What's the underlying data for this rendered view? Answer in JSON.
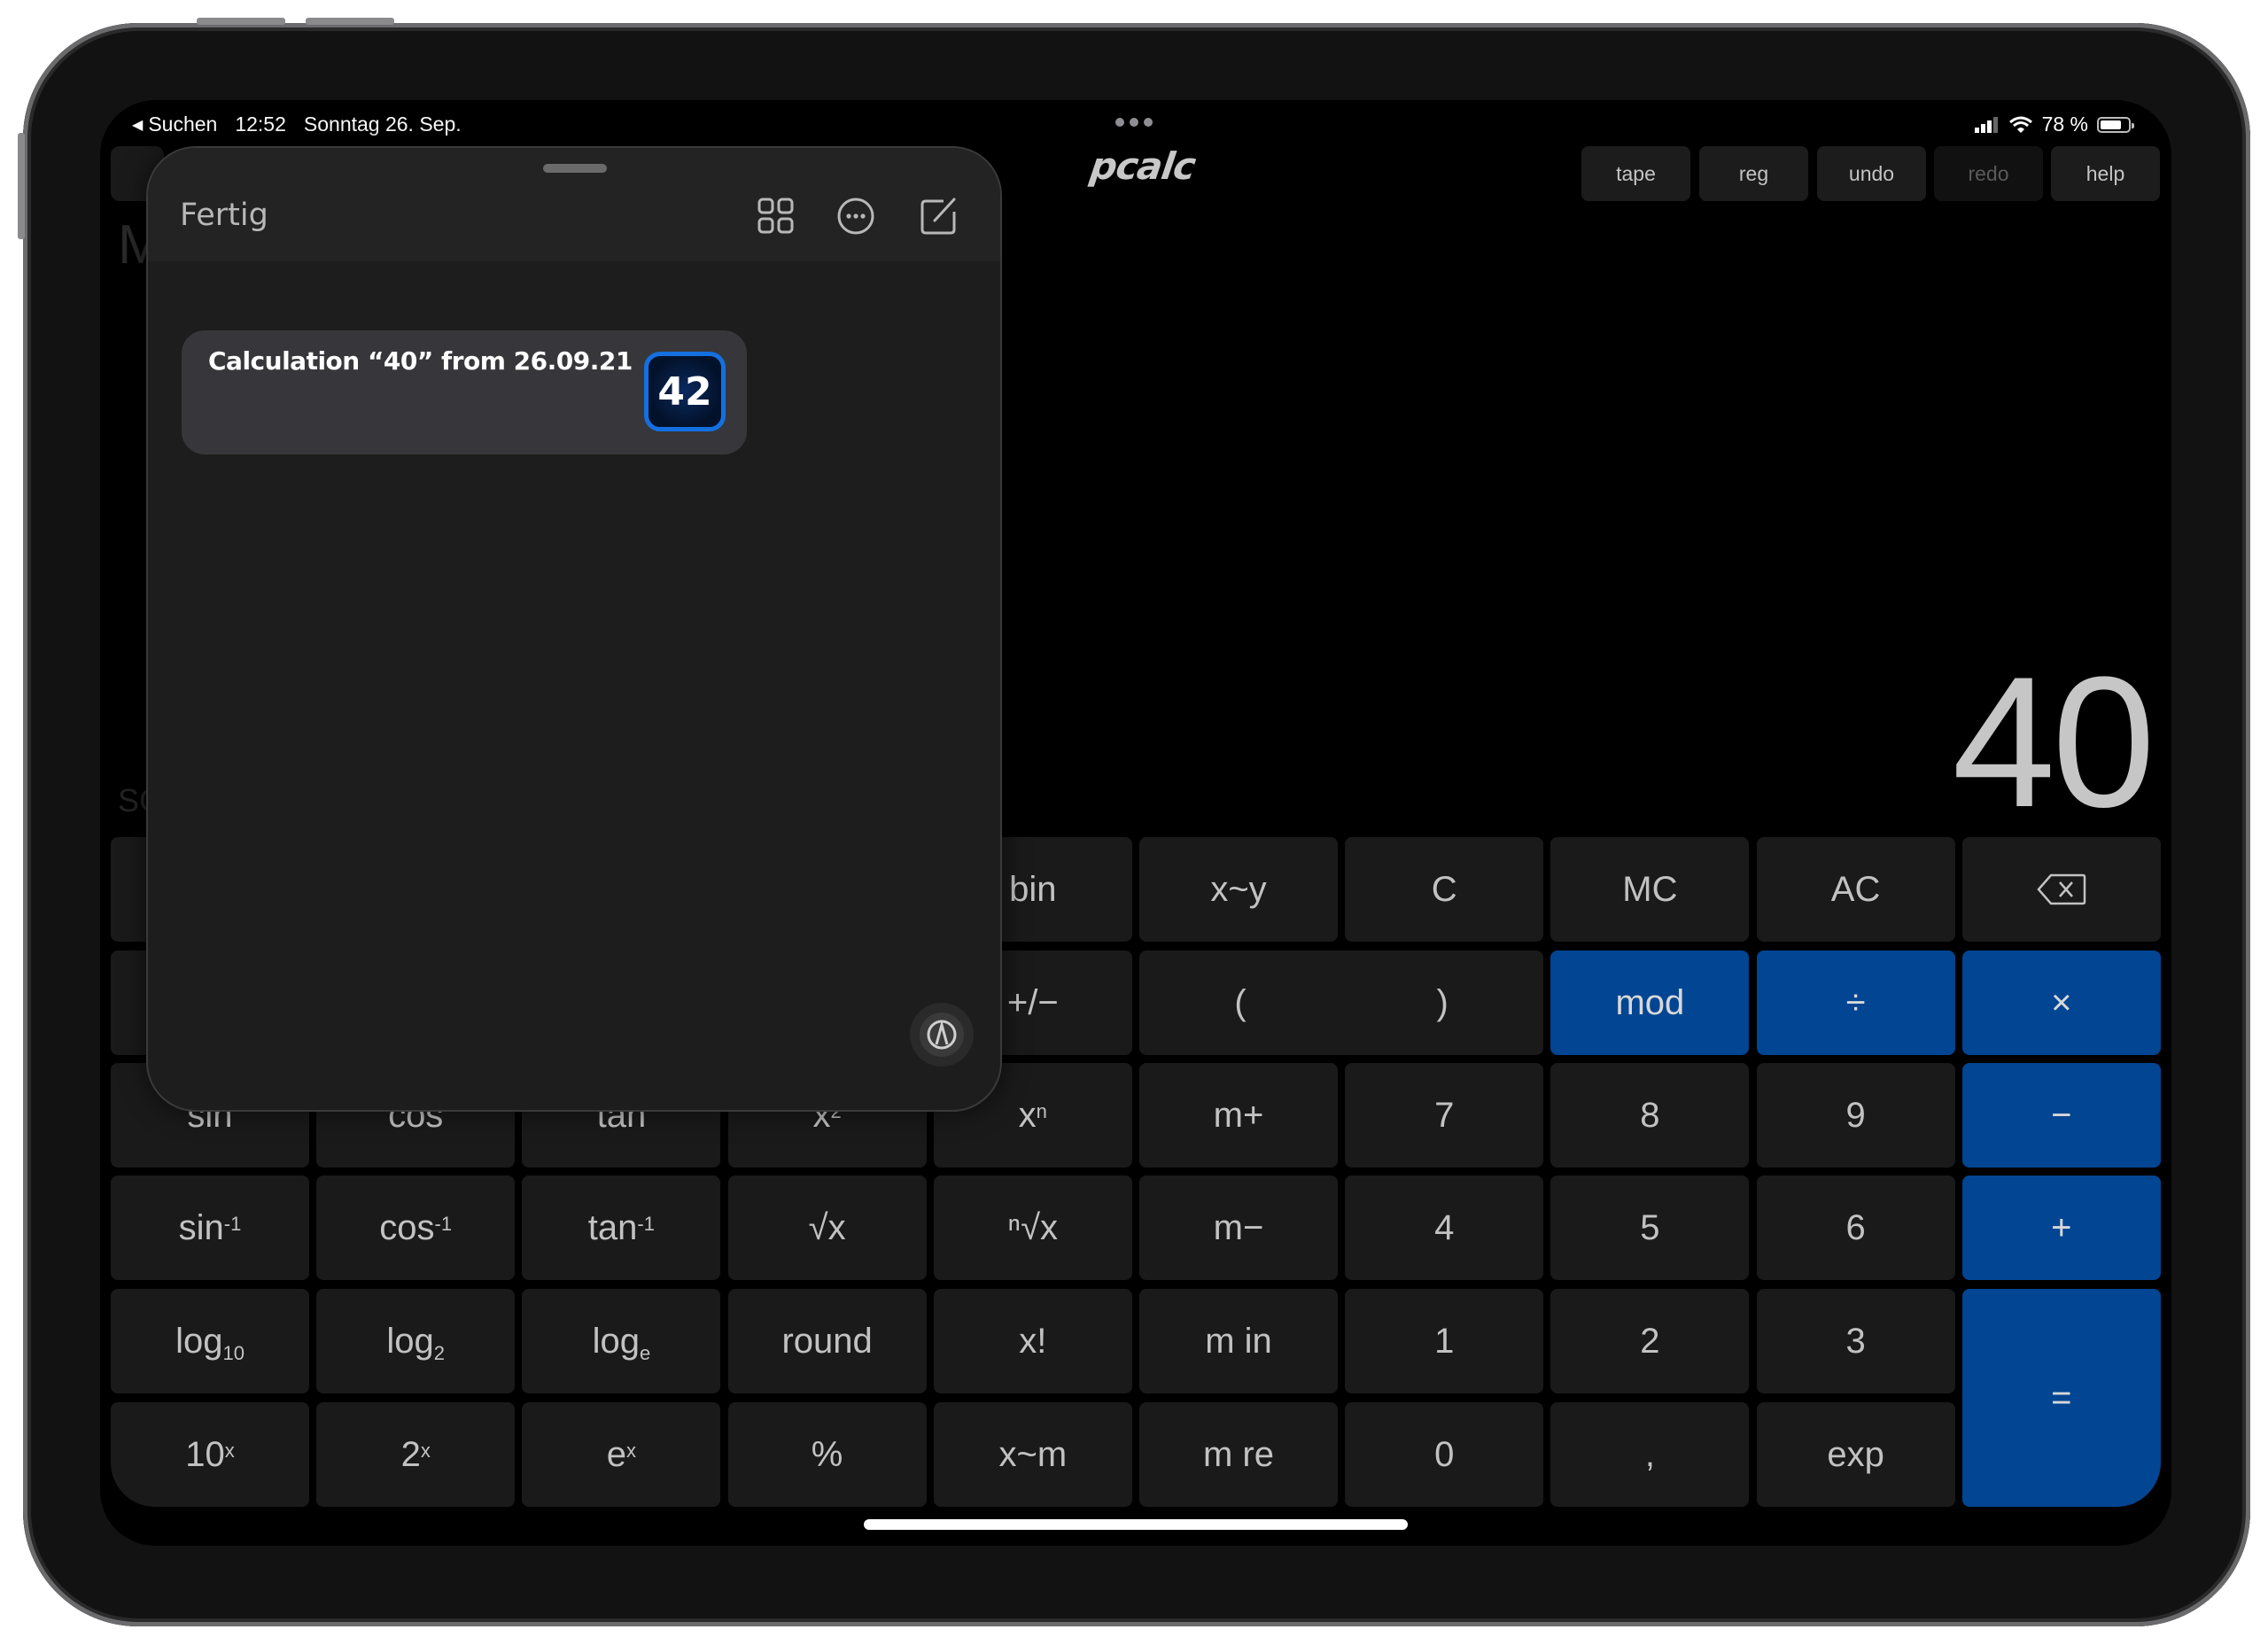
{
  "status_bar": {
    "back_label": "Suchen",
    "time": "12:52",
    "date": "Sonntag 26. Sep.",
    "battery_text": "78 %",
    "battery_level": 0.78
  },
  "app": {
    "logo": "pcalc",
    "top_buttons": [
      {
        "label": "tape",
        "enabled": true
      },
      {
        "label": "reg",
        "enabled": true
      },
      {
        "label": "undo",
        "enabled": true
      },
      {
        "label": "redo",
        "enabled": false
      },
      {
        "label": "help",
        "enabled": true
      }
    ],
    "display_value": "40",
    "background_hint_mode": "M",
    "background_hint_sci": "SC"
  },
  "sheet": {
    "done_label": "Fertig",
    "header_icons": [
      "grid-icon",
      "more-icon",
      "compose-icon"
    ],
    "shortcut": {
      "title": "Calculation “40” from 26.09.21",
      "app_icon_text": "42"
    },
    "bottom_icon": "compass-icon"
  },
  "keypad": {
    "rows": [
      [
        {
          "label": "",
          "hidden": true
        },
        {
          "label": "",
          "hidden": true
        },
        {
          "label": "",
          "hidden": true
        },
        {
          "label": "",
          "hidden": true
        },
        {
          "label": "bin"
        },
        {
          "label": "x~y"
        },
        {
          "label": "C"
        },
        {
          "label": "MC"
        },
        {
          "label": "AC"
        },
        {
          "label": "backspace",
          "icon": "backspace-icon"
        }
      ],
      [
        {
          "label": "",
          "hidden": true
        },
        {
          "label": "",
          "hidden": true
        },
        {
          "label": "",
          "hidden": true
        },
        {
          "label": "",
          "hidden": true
        },
        {
          "label": "+/−"
        },
        {
          "label": "(   )",
          "left": "(",
          "right": ")",
          "span": 2
        },
        {
          "label": "mod",
          "blue": true
        },
        {
          "label": "÷",
          "blue": true
        },
        {
          "label": "×",
          "blue": true
        }
      ],
      [
        {
          "label": "sin"
        },
        {
          "label": "cos"
        },
        {
          "label": "tan"
        },
        {
          "base": "x",
          "sup": "2"
        },
        {
          "base": "x",
          "sup": "n"
        },
        {
          "label": "m+"
        },
        {
          "label": "7"
        },
        {
          "label": "8"
        },
        {
          "label": "9"
        },
        {
          "label": "−",
          "blue": true
        }
      ],
      [
        {
          "base": "sin",
          "sup": "-1"
        },
        {
          "base": "cos",
          "sup": "-1"
        },
        {
          "base": "tan",
          "sup": "-1"
        },
        {
          "label": "√x"
        },
        {
          "label": "ⁿ√x"
        },
        {
          "label": "m−"
        },
        {
          "label": "4"
        },
        {
          "label": "5"
        },
        {
          "label": "6"
        },
        {
          "label": "+",
          "blue": true
        }
      ],
      [
        {
          "base": "log",
          "sub": "10"
        },
        {
          "base": "log",
          "sub": "2"
        },
        {
          "base": "log",
          "sub": "e"
        },
        {
          "label": "round"
        },
        {
          "label": "x!"
        },
        {
          "label": "m in"
        },
        {
          "label": "1"
        },
        {
          "label": "2"
        },
        {
          "label": "3"
        },
        {
          "label": "=",
          "blue": true,
          "rowspan": 2
        }
      ],
      [
        {
          "base": "10",
          "sup": "x"
        },
        {
          "base": "2",
          "sup": "x"
        },
        {
          "base": "e",
          "sup": "x"
        },
        {
          "label": "%"
        },
        {
          "label": "x~m"
        },
        {
          "label": "m re"
        },
        {
          "label": "0"
        },
        {
          "label": ","
        },
        {
          "label": "exp"
        }
      ]
    ]
  },
  "colors": {
    "accent_blue": "#024592",
    "key_bg": "#1a1a1a",
    "sheet_bg": "#1d1d1d",
    "card_bg": "#37373b",
    "app_icon_border": "#1470e0"
  }
}
